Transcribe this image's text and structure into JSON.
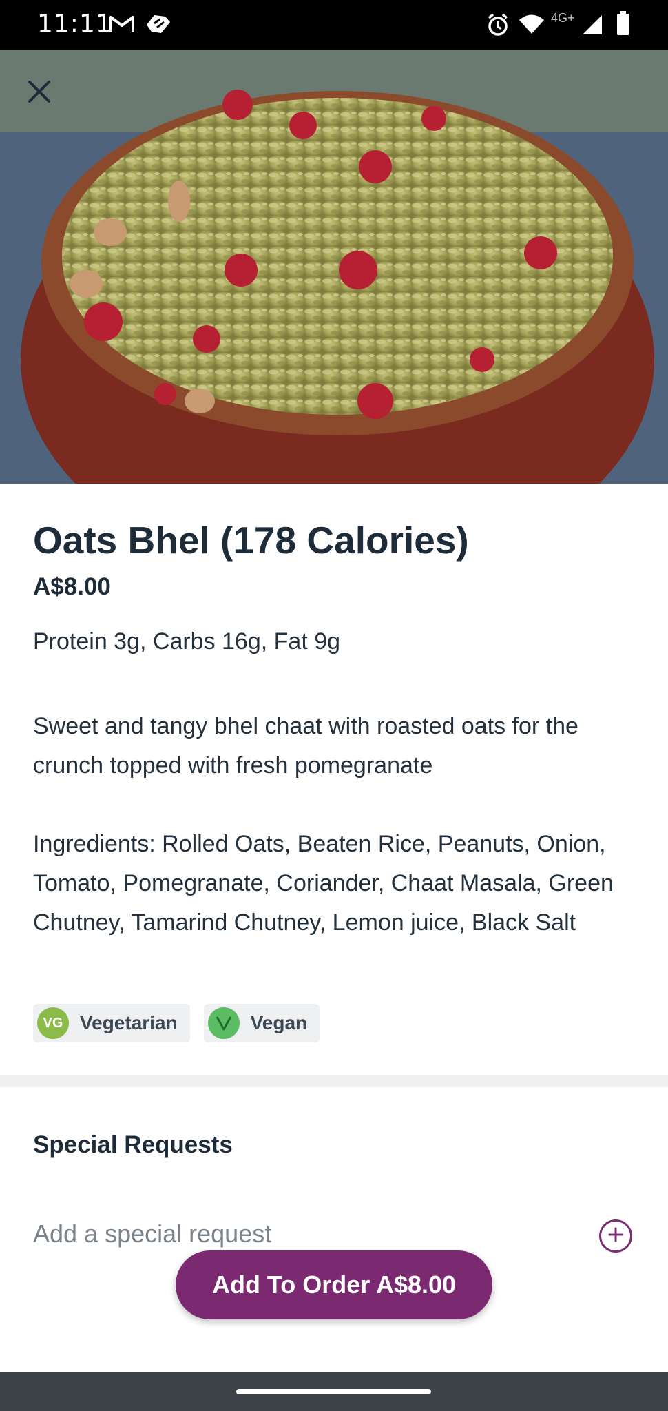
{
  "status_bar": {
    "time": "11:11",
    "network_label": "4G+",
    "icons": [
      "gmail-icon",
      "app-icon",
      "alarm-icon",
      "wifi-icon",
      "signal-icon",
      "battery-icon"
    ]
  },
  "header": {
    "close_icon": "close-icon"
  },
  "item": {
    "title": "Oats Bhel (178 Calories)",
    "price": "A$8.00",
    "macros": "Protein 3g, Carbs 16g, Fat 9g",
    "description": "Sweet and tangy bhel chaat with roasted oats for the crunch topped with fresh pomegranate",
    "ingredients": "Ingredients: Rolled Oats, Beaten Rice, Peanuts, Onion, Tomato, Pomegranate, Coriander, Chaat Masala, Green Chutney, Tamarind Chutney, Lemon juice, Black Salt",
    "tags": [
      {
        "badge": "VG",
        "label": "Vegetarian",
        "color": "#8dbb4a"
      },
      {
        "badge": "V",
        "label": "Vegan",
        "color": "#5cbc63"
      }
    ]
  },
  "special_requests": {
    "heading": "Special Requests",
    "placeholder": "Add a special request"
  },
  "cta": {
    "label": "Add To Order A$8.00"
  },
  "colors": {
    "accent": "#7b2a72",
    "text": "#1e2b38",
    "divider": "#eef0f2"
  }
}
